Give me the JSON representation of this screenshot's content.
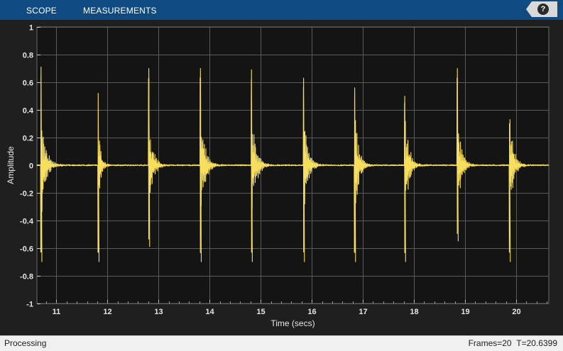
{
  "toolbar": {
    "tabs": [
      {
        "label": "SCOPE"
      },
      {
        "label": "MEASUREMENTS"
      }
    ],
    "help_label": "?",
    "help_icon": "help-icon"
  },
  "colors": {
    "toolbar_bg": "#0f4a80",
    "plot_bg": "#141414",
    "figure_bg": "#1f1f1f",
    "grid": "#5a5a5a",
    "axis_text": "#e6e6e6",
    "signal": "#f7de5e",
    "status_bg": "#f0f0f0"
  },
  "status": {
    "left": "Processing",
    "frames": "Frames=20",
    "time": "T=20.6399"
  },
  "chart_data": {
    "type": "line",
    "title": "",
    "xlabel": "Time (secs)",
    "ylabel": "Amplitude",
    "xlim": [
      10.62,
      20.64
    ],
    "ylim": [
      -1,
      1
    ],
    "xticks": [
      11,
      12,
      13,
      14,
      15,
      16,
      17,
      18,
      19,
      20
    ],
    "yticks": [
      -1,
      -0.8,
      -0.6,
      -0.4,
      -0.2,
      0,
      0.2,
      0.4,
      0.6,
      0.8,
      1
    ],
    "grid": true,
    "legend": "none",
    "series": [
      {
        "style": "damped-transients",
        "events": [
          {
            "t": 10.7,
            "peak": 0.71,
            "trough": -0.7,
            "decay": 0.35
          },
          {
            "t": 11.82,
            "peak": 0.52,
            "trough": -0.7,
            "decay": 0.18
          },
          {
            "t": 12.81,
            "peak": 0.7,
            "trough": -0.59,
            "decay": 0.3
          },
          {
            "t": 13.82,
            "peak": 0.7,
            "trough": -0.7,
            "decay": 0.35
          },
          {
            "t": 14.82,
            "peak": 0.69,
            "trough": -0.7,
            "decay": 0.35
          },
          {
            "t": 15.84,
            "peak": 0.63,
            "trough": -0.7,
            "decay": 0.32
          },
          {
            "t": 16.84,
            "peak": 0.56,
            "trough": -0.7,
            "decay": 0.3
          },
          {
            "t": 17.82,
            "peak": 0.5,
            "trough": -0.7,
            "decay": 0.32
          },
          {
            "t": 18.85,
            "peak": 0.7,
            "trough": -0.55,
            "decay": 0.3
          },
          {
            "t": 19.87,
            "peak": 0.3,
            "trough": -0.7,
            "decay": 0.3
          }
        ]
      }
    ]
  }
}
